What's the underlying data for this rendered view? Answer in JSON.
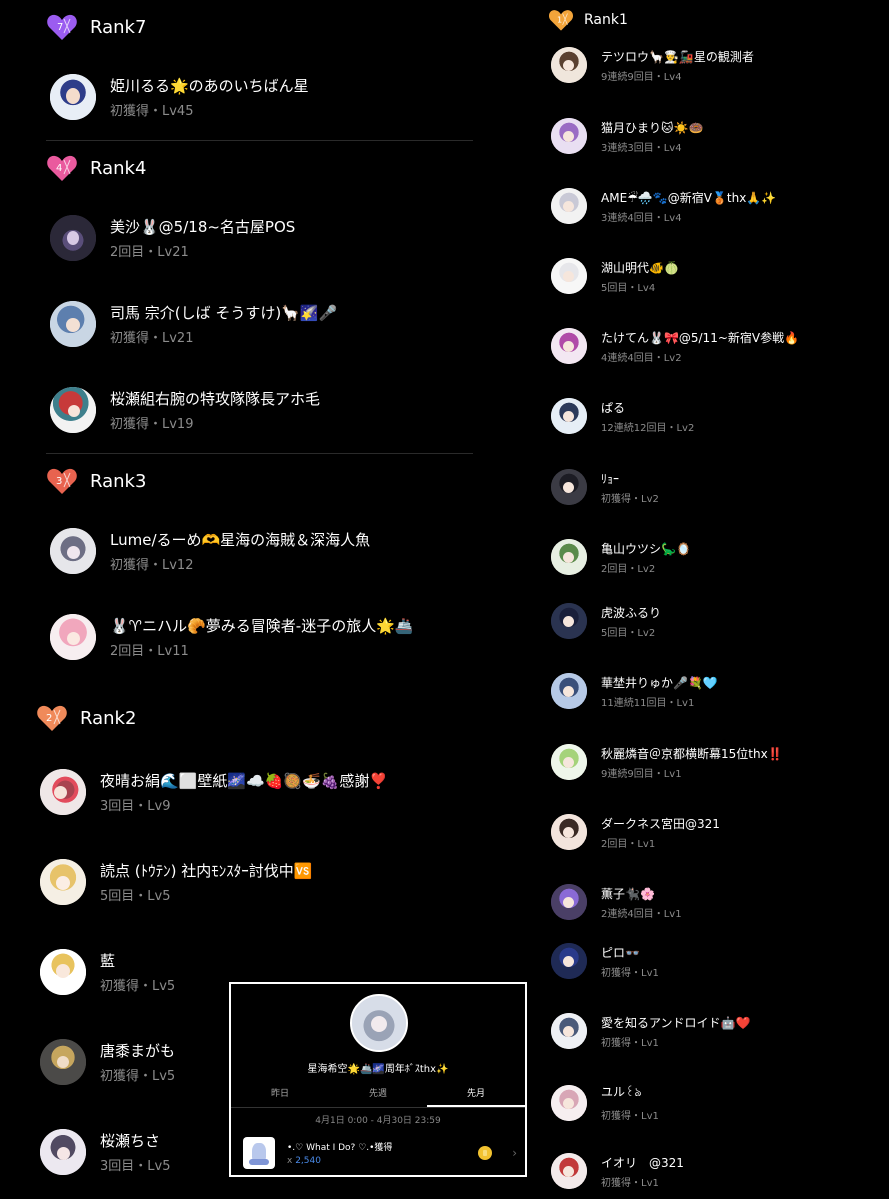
{
  "colors": {
    "rank7": "#9b5cf0",
    "rank4": "#ea5a9e",
    "rank3": "#e8634f",
    "rank2": "#f08a5a",
    "rank1": "#f2a43a",
    "meta_gray": "#8c8c8c",
    "count_blue": "#4a8ae8"
  },
  "left_ranks": [
    {
      "rank_number": "7",
      "title": "Rank7",
      "entries": [
        {
          "name": "姫川るる🌟のあのいちばん星",
          "meta": "初獲得・Lv45"
        }
      ]
    },
    {
      "rank_number": "4",
      "title": "Rank4",
      "entries": [
        {
          "name": "美沙🐰@5/18~名古屋POS",
          "meta": "2回目・Lv21"
        },
        {
          "name": "司馬 宗介(しば そうすけ)🦙🌠🎤",
          "meta": "初獲得・Lv21"
        },
        {
          "name": "桜瀬組右腕の特攻隊隊長アホ毛",
          "meta": "初獲得・Lv19"
        }
      ]
    },
    {
      "rank_number": "3",
      "title": "Rank3",
      "entries": [
        {
          "name": "Lume/るーめ🫶星海の海賊＆深海人魚",
          "meta": "初獲得・Lv12"
        },
        {
          "name": "🐰♈ニハル🥐夢みる冒険者-迷子の旅人🌟🚢",
          "meta": "2回目・Lv11"
        }
      ]
    },
    {
      "rank_number": "2",
      "title": "Rank2",
      "entries": [
        {
          "name": "夜晴お絹🌊⬜壁紙🌌☁️🍓🥘🍜🍇感謝❣️",
          "meta": "3回目・Lv9"
        },
        {
          "name": "読点 (ﾄｳﾃﾝ) 社内ﾓﾝｽﾀｰ討伐中🆚",
          "meta": "5回目・Lv5"
        },
        {
          "name": "藍",
          "meta": "初獲得・Lv5"
        },
        {
          "name": "唐黍まがも",
          "meta": "初獲得・Lv5"
        },
        {
          "name": "桜瀬ちさ",
          "meta": "3回目・Lv5"
        }
      ]
    }
  ],
  "right_rank": {
    "rank_number": "1",
    "title": "Rank1",
    "entries": [
      {
        "name": "テツロウ🦙👨‍🍳🚂星の観測者",
        "meta": "9連続9回目・Lv4"
      },
      {
        "name": "猫月ひまり🐱☀️🍩",
        "meta": "3連続3回目・Lv4"
      },
      {
        "name": "AME☔🌧️🐾@新宿Ⅴ🥉thx🙏✨",
        "meta": "3連続4回目・Lv4"
      },
      {
        "name": "湖山明代🐠🍈",
        "meta": "5回目・Lv4"
      },
      {
        "name": "たけてん🐰🎀@5/11~新宿Ⅴ参戦🔥",
        "meta": "4連続4回目・Lv2"
      },
      {
        "name": "ぱる",
        "meta": "12連続12回目・Lv2"
      },
      {
        "name": "ﾘｮｰ",
        "meta": "初獲得・Lv2"
      },
      {
        "name": "亀山ウツシ🦕🪞",
        "meta": "2回目・Lv2"
      },
      {
        "name": "虎波ふるり",
        "meta": "5回目・Lv2"
      },
      {
        "name": "華埜井りゅか🎤💐🩵",
        "meta": "11連続11回目・Lv1"
      },
      {
        "name": "秋麗燐音＠京都横断幕15位thx‼️",
        "meta": "9連続9回目・Lv1"
      },
      {
        "name": "ダークネス宮田@321",
        "meta": "2回目・Lv1"
      },
      {
        "name": "薫子🐈‍⬛🌸",
        "meta": "2連続4回目・Lv1"
      },
      {
        "name": "ピロ👓",
        "meta": "初獲得・Lv1"
      },
      {
        "name": "愛を知るアンドロイド🤖❤️",
        "meta": "初獲得・Lv1"
      },
      {
        "name": "ユル꒰ঌ",
        "meta": "初獲得・Lv1"
      },
      {
        "name": "イオリ　@321",
        "meta": "初獲得・Lv1"
      }
    ]
  },
  "panel": {
    "name": "星海希空🌟🚢🌌周年ﾎﾞｽthx✨",
    "tabs": [
      "昨日",
      "先週",
      "先月"
    ],
    "active_tab": "先月",
    "period": "4月1日 0:00 - 4月30日 23:59",
    "item_title": "•.♡ What I Do? ♡.•獲得",
    "item_count_prefix": "x",
    "item_count": "2,540",
    "coin_icon": "coin-icon",
    "chevron": "›"
  }
}
